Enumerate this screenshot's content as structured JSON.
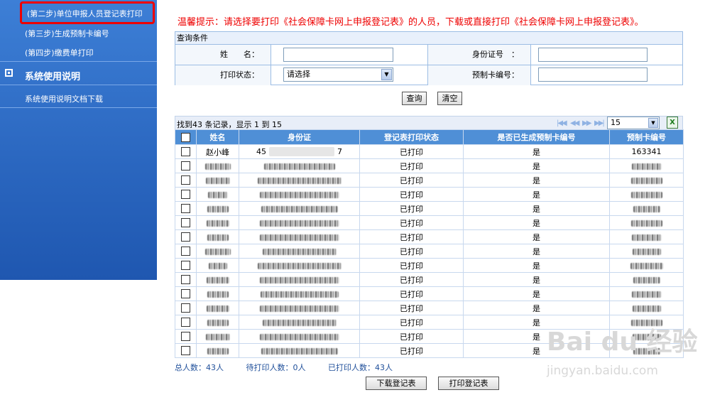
{
  "sidebar": {
    "items_top": [
      "(第二步)单位申报人员登记表打印",
      "(第三步)生成预制卡编号",
      "(第四步)缴费单打印"
    ],
    "section_title": "系统使用说明",
    "section_items": [
      "系统使用说明文档下载"
    ]
  },
  "tip": "温馨提示：请选择要打印《社会保障卡网上申报登记表》的人员，下载或直接打印《社会保障卡网上申报登记表》。",
  "query": {
    "title": "查询条件",
    "name_label": "姓　　名：",
    "id_label": "身份证号　：",
    "print_status_label": "打印状态：",
    "print_status_value": "请选择",
    "card_no_label": "预制卡编号：",
    "search_button": "查询",
    "clear_button": "清空"
  },
  "results": {
    "count_text": "找到43 条记录，显示 1 到 15",
    "page_size": "15",
    "pager_icons": [
      "first-page-icon",
      "prev-page-icon",
      "next-page-icon",
      "last-page-icon"
    ],
    "export_icon": "excel-export-icon"
  },
  "table": {
    "headers": [
      "",
      "姓名",
      "身份证",
      "登记表打印状态",
      "是否已生成预制卡编号",
      "预制卡编号"
    ],
    "first_row": {
      "name": "赵小峰",
      "id_prefix": "45",
      "id_suffix": "7",
      "status": "已打印",
      "generated": "是",
      "card_no": "163341"
    },
    "rows": [
      {
        "status": "已打印",
        "generated": "是"
      },
      {
        "status": "已打印",
        "generated": "是"
      },
      {
        "status": "已打印",
        "generated": "是"
      },
      {
        "status": "已打印",
        "generated": "是"
      },
      {
        "status": "已打印",
        "generated": "是"
      },
      {
        "status": "已打印",
        "generated": "是"
      },
      {
        "status": "已打印",
        "generated": "是"
      },
      {
        "status": "已打印",
        "generated": "是"
      },
      {
        "status": "已打印",
        "generated": "是"
      },
      {
        "status": "已打印",
        "generated": "是"
      },
      {
        "status": "已打印",
        "generated": "是"
      },
      {
        "status": "已打印",
        "generated": "是"
      },
      {
        "status": "已打印",
        "generated": "是"
      },
      {
        "status": "已打印",
        "generated": "是"
      },
      {
        "status": "已打印",
        "generated": "是"
      }
    ]
  },
  "summary": {
    "total": "总人数：43人",
    "pending": "待打印人数：0人",
    "printed": "已打印人数：43人"
  },
  "actions": {
    "download": "下载登记表",
    "print": "打印登记表"
  },
  "watermark": {
    "main": "Bai du 经验",
    "sub": "jingyan.baidu.com"
  },
  "colors": {
    "sidebar": "#2a66bf",
    "header": "#4f8fd6",
    "tip": "#e00000",
    "highlight": "#ee0000"
  }
}
